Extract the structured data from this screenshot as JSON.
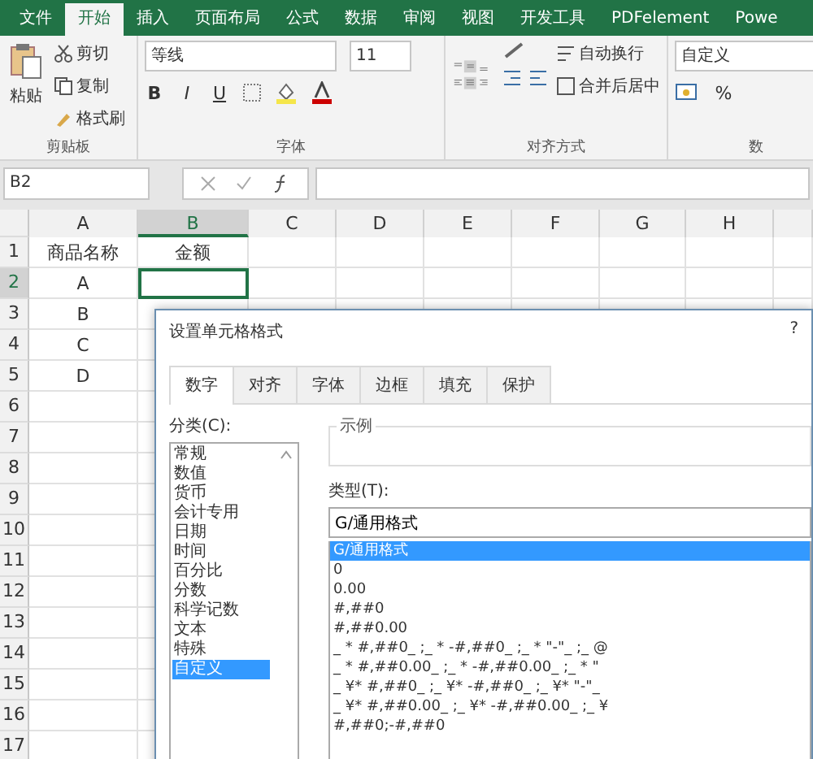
{
  "tabs": [
    {
      "label": "文件",
      "selected": false
    },
    {
      "label": "开始",
      "selected": true
    },
    {
      "label": "插入",
      "selected": false
    },
    {
      "label": "页面布局",
      "selected": false
    },
    {
      "label": "公式",
      "selected": false
    },
    {
      "label": "数据",
      "selected": false
    },
    {
      "label": "审阅",
      "selected": false
    },
    {
      "label": "视图",
      "selected": false
    },
    {
      "label": "开发工具",
      "selected": false
    },
    {
      "label": "PDFelement",
      "selected": false
    },
    {
      "label": "Powe",
      "selected": false
    }
  ],
  "clipboard": {
    "paste": "粘贴",
    "cut": "剪切",
    "copy": "复制",
    "painter": "格式刷",
    "group_label": "剪贴板"
  },
  "font": {
    "name": "等线",
    "size": "11",
    "bold": "B",
    "italic": "I",
    "underline": "U",
    "group_label": "字体"
  },
  "alignment": {
    "wrap": "自动换行",
    "merge": "合并后居中",
    "group_label": "对齐方式"
  },
  "number": {
    "format": "自定义",
    "percent": "%",
    "group_label": "数"
  },
  "formula_bar": {
    "name_box": "B2"
  },
  "columns": [
    {
      "label": "A",
      "selected": false
    },
    {
      "label": "B",
      "selected": true
    },
    {
      "label": "C",
      "selected": false
    },
    {
      "label": "D",
      "selected": false
    },
    {
      "label": "E",
      "selected": false
    },
    {
      "label": "F",
      "selected": false
    },
    {
      "label": "G",
      "selected": false
    },
    {
      "label": "H",
      "selected": false
    }
  ],
  "rows": [
    {
      "number": "1",
      "selected": false,
      "cells": [
        "商品名称",
        "金额"
      ]
    },
    {
      "number": "2",
      "selected": true,
      "cells": [
        "A"
      ]
    },
    {
      "number": "3",
      "selected": false,
      "cells": [
        "B"
      ]
    },
    {
      "number": "4",
      "selected": false,
      "cells": [
        "C"
      ]
    },
    {
      "number": "5",
      "selected": false,
      "cells": [
        "D"
      ]
    },
    {
      "number": "6",
      "selected": false,
      "cells": []
    },
    {
      "number": "7",
      "selected": false,
      "cells": []
    },
    {
      "number": "8",
      "selected": false,
      "cells": []
    },
    {
      "number": "9",
      "selected": false,
      "cells": []
    },
    {
      "number": "10",
      "selected": false,
      "cells": []
    },
    {
      "number": "11",
      "selected": false,
      "cells": []
    },
    {
      "number": "12",
      "selected": false,
      "cells": []
    },
    {
      "number": "13",
      "selected": false,
      "cells": []
    },
    {
      "number": "14",
      "selected": false,
      "cells": []
    },
    {
      "number": "15",
      "selected": false,
      "cells": []
    },
    {
      "number": "16",
      "selected": false,
      "cells": []
    },
    {
      "number": "17",
      "selected": false,
      "cells": []
    }
  ],
  "dialog": {
    "title": "设置单元格格式",
    "help": "?",
    "tabs": [
      {
        "label": "数字",
        "selected": true
      },
      {
        "label": "对齐",
        "selected": false
      },
      {
        "label": "字体",
        "selected": false
      },
      {
        "label": "边框",
        "selected": false
      },
      {
        "label": "填充",
        "selected": false
      },
      {
        "label": "保护",
        "selected": false
      }
    ],
    "category_label": "分类(C):",
    "categories": [
      {
        "label": "常规",
        "selected": false
      },
      {
        "label": "数值",
        "selected": false
      },
      {
        "label": "货币",
        "selected": false
      },
      {
        "label": "会计专用",
        "selected": false
      },
      {
        "label": "日期",
        "selected": false
      },
      {
        "label": "时间",
        "selected": false
      },
      {
        "label": "百分比",
        "selected": false
      },
      {
        "label": "分数",
        "selected": false
      },
      {
        "label": "科学记数",
        "selected": false
      },
      {
        "label": "文本",
        "selected": false
      },
      {
        "label": "特殊",
        "selected": false
      },
      {
        "label": "自定义",
        "selected": true
      }
    ],
    "sample_label": "示例",
    "type_label": "类型(T):",
    "type_value": "G/通用格式",
    "types": [
      {
        "label": "G/通用格式",
        "selected": true
      },
      {
        "label": "0",
        "selected": false
      },
      {
        "label": "0.00",
        "selected": false
      },
      {
        "label": "#,##0",
        "selected": false
      },
      {
        "label": "#,##0.00",
        "selected": false
      },
      {
        "label": "_ * #,##0_ ;_ * -#,##0_ ;_ * \"-\"_ ;_ @",
        "selected": false
      },
      {
        "label": "_ * #,##0.00_ ;_ * -#,##0.00_ ;_ * \"",
        "selected": false
      },
      {
        "label": "_ ¥* #,##0_ ;_ ¥* -#,##0_ ;_ ¥* \"-\"_",
        "selected": false
      },
      {
        "label": "_ ¥* #,##0.00_ ;_ ¥* -#,##0.00_ ;_ ¥",
        "selected": false
      },
      {
        "label": "#,##0;-#,##0",
        "selected": false
      }
    ]
  }
}
